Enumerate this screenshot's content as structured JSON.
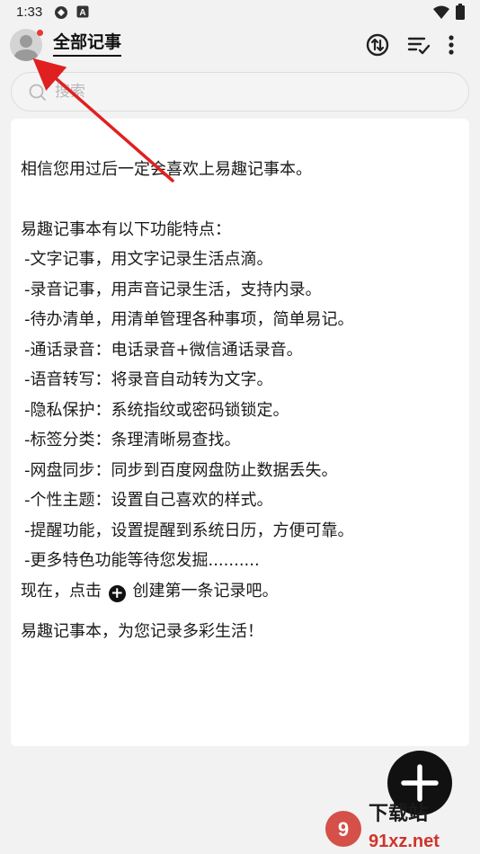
{
  "status_bar": {
    "time": "1:33"
  },
  "header": {
    "title": "全部记事",
    "icons": [
      "avatar",
      "sync-icon",
      "sort-icon",
      "more-icon"
    ]
  },
  "search": {
    "placeholder": "搜索",
    "value": ""
  },
  "note": {
    "intro": "相信您用过后一定会喜欢上易趣记事本。",
    "heading": "易趣记事本有以下功能特点：",
    "features": [
      "-文字记事，用文字记录生活点滴。",
      "-录音记事，用声音记录生活，支持内录。",
      "-待办清单，用清单管理各种事项，简单易记。",
      "-通话录音：电话录音+微信通话录音。",
      "-语音转写：将录音自动转为文字。",
      "-隐私保护：系统指纹或密码锁锁定。",
      "-标签分类：条理清晰易查找。",
      "-网盘同步：同步到百度网盘防止数据丢失。",
      "-个性主题：设置自己喜欢的样式。",
      "-提醒功能，设置提醒到系统日历，方便可靠。",
      "-更多特色功能等待您发掘.........."
    ],
    "now_prefix": "现在，点击",
    "now_suffix": "创建第一条记录吧。",
    "closing": "易趣记事本，为您记录多彩生活！"
  },
  "watermark": {
    "text_top": "下载站",
    "text_bottom": "91xz.net"
  },
  "colors": {
    "background": "#f2f2f2",
    "card": "#ffffff",
    "fab": "#111111",
    "notification_dot": "#e53935",
    "annotation_arrow": "#e02020",
    "watermark": "#d0342c"
  }
}
